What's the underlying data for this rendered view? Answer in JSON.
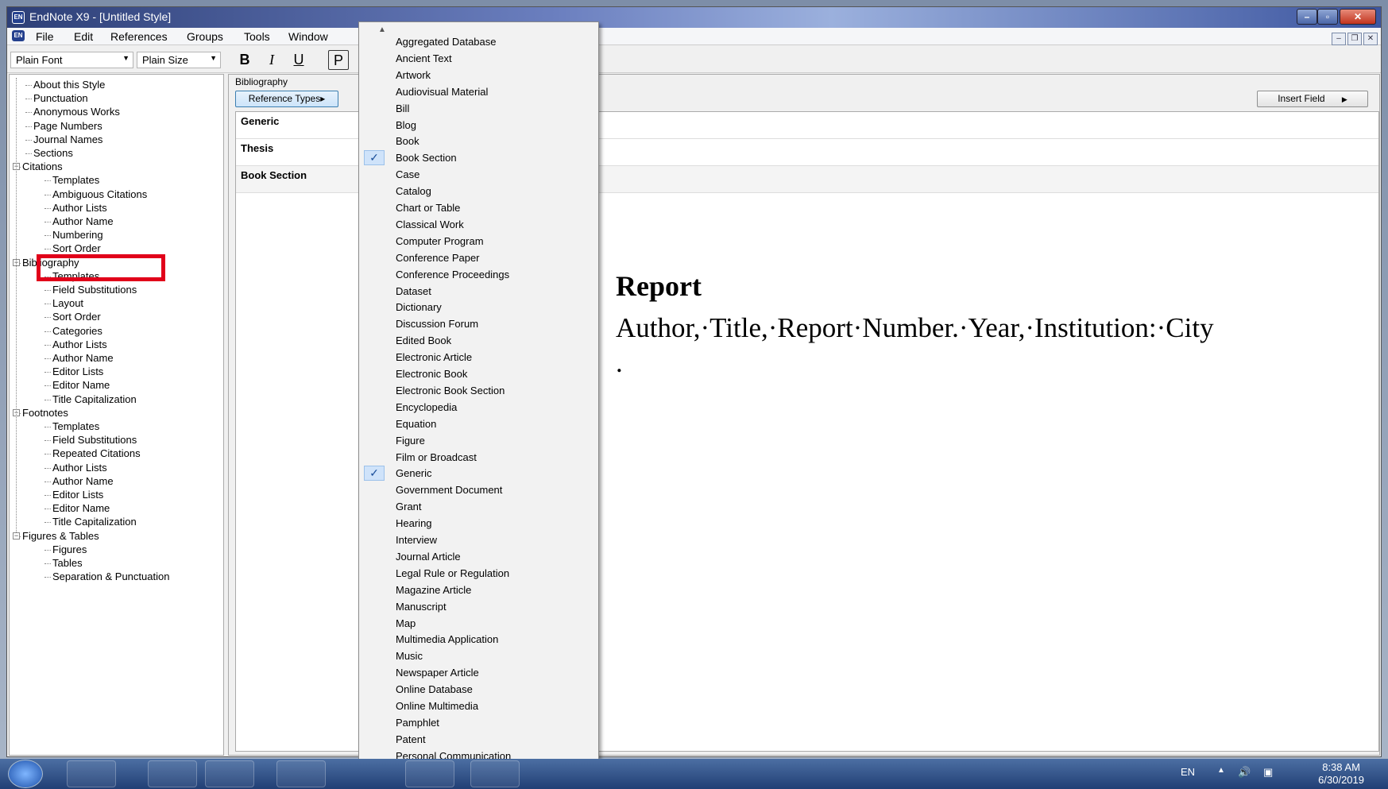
{
  "window": {
    "title": "EndNote X9 - [Untitled Style]",
    "app_icon": "EN"
  },
  "menu": [
    "File",
    "Edit",
    "References",
    "Groups",
    "Tools",
    "Window"
  ],
  "toolbar": {
    "font": "Plain Font",
    "size": "Plain Size",
    "bold": "B",
    "italic": "I",
    "underline": "U",
    "plain": "P"
  },
  "tree": [
    {
      "label": "About this Style",
      "level": 1
    },
    {
      "label": "Punctuation",
      "level": 1
    },
    {
      "label": "Anonymous Works",
      "level": 1
    },
    {
      "label": "Page Numbers",
      "level": 1
    },
    {
      "label": "Journal Names",
      "level": 1
    },
    {
      "label": "Sections",
      "level": 1
    },
    {
      "label": "Citations",
      "level": 0
    },
    {
      "label": "Templates",
      "level": 2
    },
    {
      "label": "Ambiguous Citations",
      "level": 2
    },
    {
      "label": "Author Lists",
      "level": 2
    },
    {
      "label": "Author Name",
      "level": 2
    },
    {
      "label": "Numbering",
      "level": 2
    },
    {
      "label": "Sort Order",
      "level": 2
    },
    {
      "label": "Bibliography",
      "level": 0
    },
    {
      "label": "Templates",
      "level": 2
    },
    {
      "label": "Field Substitutions",
      "level": 2
    },
    {
      "label": "Layout",
      "level": 2
    },
    {
      "label": "Sort Order",
      "level": 2
    },
    {
      "label": "Categories",
      "level": 2
    },
    {
      "label": "Author Lists",
      "level": 2
    },
    {
      "label": "Author Name",
      "level": 2
    },
    {
      "label": "Editor Lists",
      "level": 2
    },
    {
      "label": "Editor Name",
      "level": 2
    },
    {
      "label": "Title Capitalization",
      "level": 2
    },
    {
      "label": "Footnotes",
      "level": 0
    },
    {
      "label": "Templates",
      "level": 2
    },
    {
      "label": "Field Substitutions",
      "level": 2
    },
    {
      "label": "Repeated Citations",
      "level": 2
    },
    {
      "label": "Author Lists",
      "level": 2
    },
    {
      "label": "Author Name",
      "level": 2
    },
    {
      "label": "Editor Lists",
      "level": 2
    },
    {
      "label": "Editor Name",
      "level": 2
    },
    {
      "label": "Title Capitalization",
      "level": 2
    },
    {
      "label": "Figures & Tables",
      "level": 0
    },
    {
      "label": "Figures",
      "level": 2
    },
    {
      "label": "Tables",
      "level": 2
    },
    {
      "label": "Separation & Punctuation",
      "level": 2
    }
  ],
  "main": {
    "section_label": "Bibliography",
    "reference_types_button": "Reference Types▸",
    "insert_field_button": "Insert Field",
    "template_rows": [
      "Generic",
      "Thesis",
      "Book Section"
    ],
    "preview_title": "Report",
    "preview_line": "Author,·Title,·Report·Number.·Year,·Institution:·City",
    "preview_tail": "."
  },
  "dropdown": {
    "items": [
      "Aggregated Database",
      "Ancient Text",
      "Artwork",
      "Audiovisual Material",
      "Bill",
      "Blog",
      "Book",
      "Book Section",
      "Case",
      "Catalog",
      "Chart or Table",
      "Classical Work",
      "Computer Program",
      "Conference Paper",
      "Conference Proceedings",
      "Dataset",
      "Dictionary",
      "Discussion Forum",
      "Edited Book",
      "Electronic Article",
      "Electronic Book",
      "Electronic Book Section",
      "Encyclopedia",
      "Equation",
      "Figure",
      "Film or Broadcast",
      "Generic",
      "Government Document",
      "Grant",
      "Hearing",
      "Interview",
      "Journal Article",
      "Legal Rule or Regulation",
      "Magazine Article",
      "Manuscript",
      "Map",
      "Multimedia Application",
      "Music",
      "Newspaper Article",
      "Online Database",
      "Online Multimedia",
      "Pamphlet",
      "Patent",
      "Personal Communication"
    ],
    "checked": [
      "Book Section",
      "Generic"
    ],
    "check_glyph": "✓"
  },
  "taskbar": {
    "lang": "EN",
    "time": "8:38 AM",
    "date": "6/30/2019"
  }
}
